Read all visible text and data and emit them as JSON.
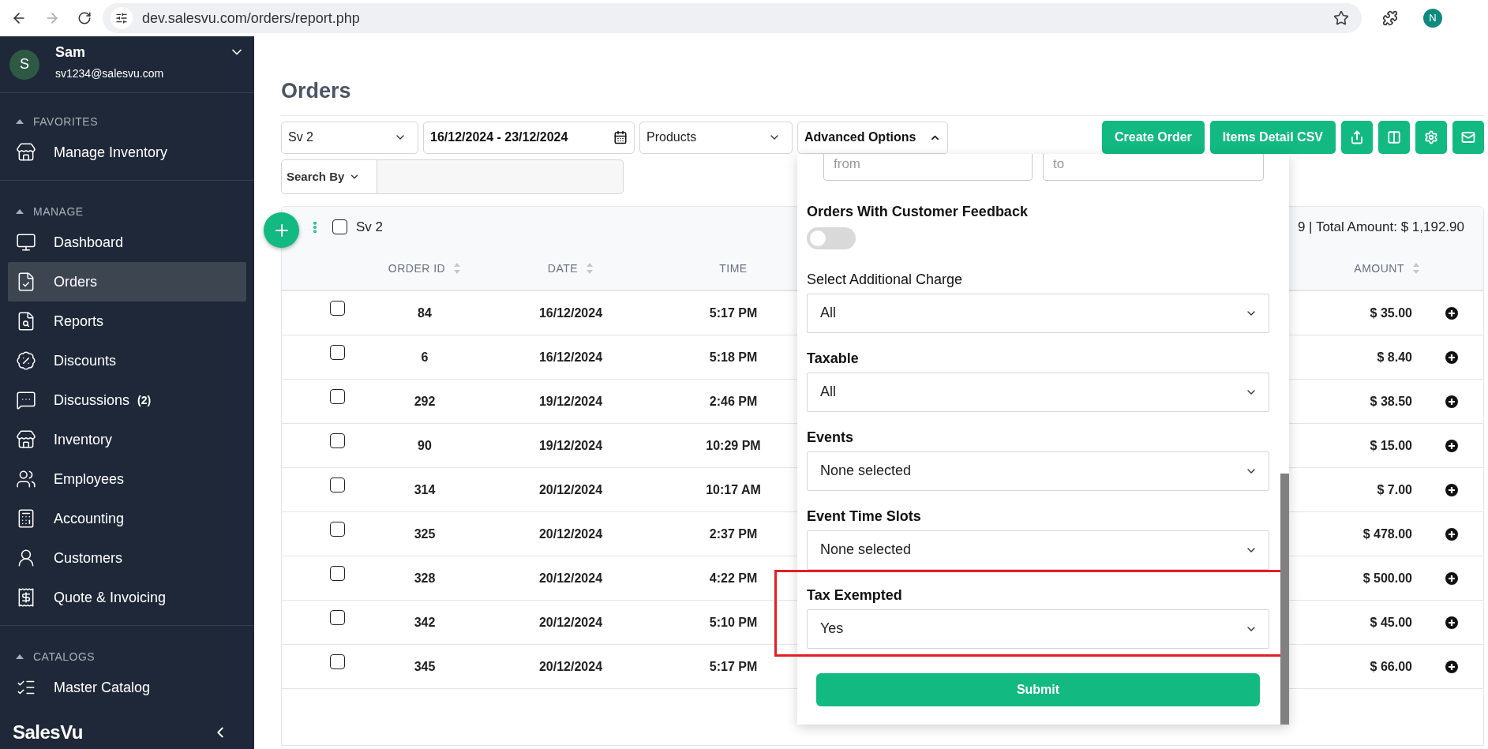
{
  "browser": {
    "url": "dev.salesvu.com/orders/report.php",
    "profile_initial": "N"
  },
  "sidebar": {
    "user": {
      "initial": "S",
      "name": "Sam",
      "email": "sv1234@salesvu.com"
    },
    "sections": [
      {
        "title": "FAVORITES",
        "expanded": true,
        "items": [
          {
            "label": "Manage Inventory",
            "kind": "store",
            "selected": false
          }
        ]
      },
      {
        "title": "MANAGE",
        "expanded": true,
        "items": [
          {
            "label": "Dashboard",
            "kind": "monitor",
            "selected": false
          },
          {
            "label": "Orders",
            "kind": "orders",
            "selected": true
          },
          {
            "label": "Reports",
            "kind": "reports",
            "selected": false
          },
          {
            "label": "Discounts",
            "kind": "percent",
            "selected": false
          },
          {
            "label": "Discussions",
            "badge": "(2)",
            "kind": "chat",
            "selected": false
          },
          {
            "label": "Inventory",
            "kind": "store",
            "selected": false
          },
          {
            "label": "Employees",
            "kind": "people",
            "selected": false
          },
          {
            "label": "Accounting",
            "kind": "calculator",
            "selected": false
          },
          {
            "label": "Customers",
            "kind": "user",
            "selected": false
          },
          {
            "label": "Quote & Invoicing",
            "kind": "invoice",
            "selected": false
          }
        ]
      },
      {
        "title": "CATALOGS",
        "expanded": true,
        "items": [
          {
            "label": "Master Catalog",
            "kind": "catalog",
            "selected": false
          }
        ]
      }
    ],
    "brand": "SalesVu"
  },
  "page": {
    "title": "Orders"
  },
  "toolbar": {
    "location": "Sv 2",
    "date_range": "16/12/2024 - 23/12/2024",
    "products": "Products",
    "advanced": {
      "label": "Advanced Options",
      "expanded": true
    },
    "buttons": [
      {
        "label": "Create Order"
      },
      {
        "label": "Items Detail CSV"
      }
    ],
    "icon_buttons": [
      {
        "kind": "share"
      },
      {
        "kind": "columns"
      },
      {
        "kind": "settings"
      },
      {
        "kind": "mail"
      }
    ],
    "search_by": "Search By"
  },
  "orders": {
    "group": {
      "label": "Sv 2",
      "checked": false
    },
    "summary": "9 | Total Amount: $ 1,192.90",
    "columns": [
      {
        "label": "ORDER ID",
        "sortable": true
      },
      {
        "label": "DATE",
        "sortable": true
      },
      {
        "label": "TIME",
        "sortable": false
      },
      {
        "label": "AMOUNT",
        "sortable": true
      }
    ],
    "rows": [
      {
        "checked": false,
        "order_id": "84",
        "date": "16/12/2024",
        "time": "5:17 PM",
        "amount": "$ 35.00"
      },
      {
        "checked": false,
        "order_id": "6",
        "date": "16/12/2024",
        "time": "5:18 PM",
        "amount": "$ 8.40"
      },
      {
        "checked": false,
        "order_id": "292",
        "date": "19/12/2024",
        "time": "2:46 PM",
        "amount": "$ 38.50"
      },
      {
        "checked": false,
        "order_id": "90",
        "date": "19/12/2024",
        "time": "10:29 PM",
        "amount": "$ 15.00"
      },
      {
        "checked": false,
        "order_id": "314",
        "date": "20/12/2024",
        "time": "10:17 AM",
        "amount": "$ 7.00"
      },
      {
        "checked": false,
        "order_id": "325",
        "date": "20/12/2024",
        "time": "2:37 PM",
        "amount": "$ 478.00"
      },
      {
        "checked": false,
        "order_id": "328",
        "date": "20/12/2024",
        "time": "4:22 PM",
        "amount": "$ 500.00"
      },
      {
        "checked": false,
        "order_id": "342",
        "date": "20/12/2024",
        "time": "5:10 PM",
        "amount": "$ 45.00"
      },
      {
        "checked": false,
        "order_id": "345",
        "date": "20/12/2024",
        "time": "5:17 PM",
        "amount": "$ 66.00"
      }
    ]
  },
  "advanced_panel": {
    "range": {
      "from_placeholder": "from",
      "to_placeholder": "to"
    },
    "feedback": {
      "label": "Orders With Customer Feedback",
      "on": false
    },
    "fields": [
      {
        "label": "Select Additional Charge",
        "value": "All",
        "bold": false,
        "highlighted": false
      },
      {
        "label": "Taxable",
        "value": "All",
        "bold": true,
        "highlighted": false
      },
      {
        "label": "Events",
        "value": "None selected",
        "bold": true,
        "highlighted": false
      },
      {
        "label": "Event Time Slots",
        "value": "None selected",
        "bold": true,
        "highlighted": false
      },
      {
        "label": "Tax Exempted",
        "value": "Yes",
        "bold": true,
        "highlighted": true
      }
    ],
    "submit": "Submit"
  }
}
